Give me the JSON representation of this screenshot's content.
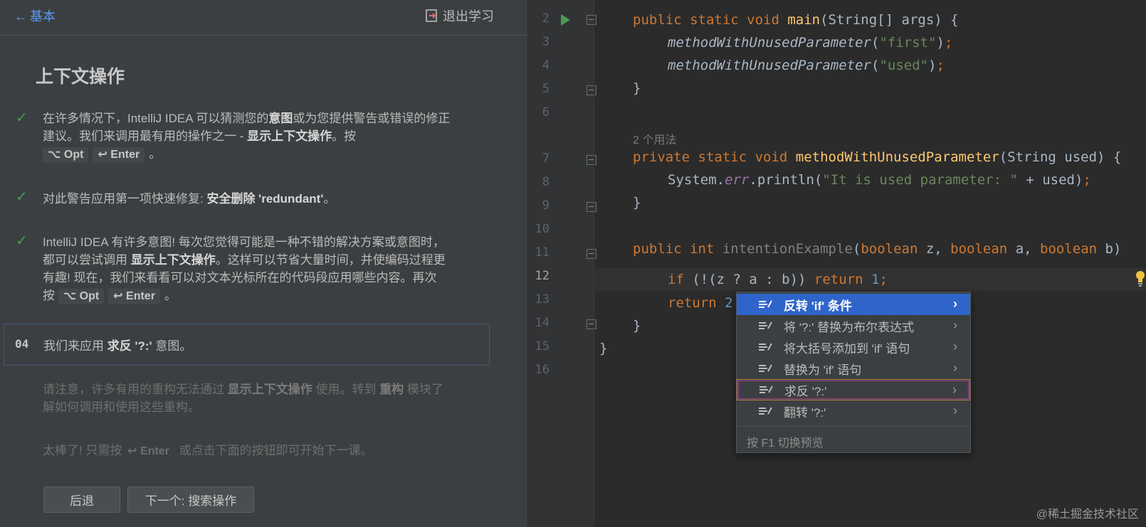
{
  "learn": {
    "back_label": "基本",
    "exit_label": "退出学习",
    "title": "上下文操作",
    "step1": {
      "t1": "在许多情况下，IntelliJ IDEA 可以猜测您的",
      "t1b": "意图",
      "t2": "或为您提供警告或错误的修正",
      "t3": "建议。我们来调用最有用的操作之一 - ",
      "t3b": "显示上下文操作",
      "t4": "。按",
      "k1": "⌥ Opt",
      "k2": "↩ Enter",
      "t5": "。"
    },
    "step2": {
      "t1": "对此警告应用第一项快速修复: ",
      "t1b": "安全删除 'redundant'",
      "t2": "。"
    },
    "step3": {
      "t1": "IntelliJ IDEA 有许多意图! 每次您觉得可能是一种不错的解决方案或意图时，",
      "t2": "都可以尝试调用 ",
      "t2b": "显示上下文操作",
      "t3": "。这样可以节省大量时间，并使编码过程更",
      "t4": "有趣! 现在，我们来看看可以对文本光标所在的代码段应用哪些内容。再次",
      "t5": "按",
      "k1": "⌥ Opt",
      "k2": "↩ Enter",
      "t6": "。"
    },
    "current": {
      "num": "04",
      "t1": "我们来应用 ",
      "t1b": "求反 '?:'",
      "t2": " 意图。"
    },
    "note1": {
      "t1": "请注意，许多有用的重构无法通过 ",
      "t1b": "显示上下文操作",
      "t2": " 使用。转到 ",
      "t2b": "重构",
      "t3": " 模块了",
      "t4": "解如何调用和使用这些重构。"
    },
    "note2": {
      "t1": "太棒了! 只需按 ",
      "k1": "↩ Enter",
      "t2": " 或点击下面的按钮即可开始下一课。"
    },
    "btn_back": "后退",
    "btn_next": "下一个: 搜索操作"
  },
  "editor": {
    "line_numbers": [
      "2",
      "3",
      "4",
      "5",
      "6",
      "7",
      "8",
      "9",
      "10",
      "11",
      "12",
      "13",
      "14",
      "15",
      "16"
    ],
    "usages_hint": "2 个用法",
    "code": {
      "l2_kw": "public static void ",
      "l2_fn": "main",
      "l2_rest": "(String[] args) {",
      "l3_call": "methodWithUnusedParameter",
      "l3_str": "\"first\"",
      "l4_call": "methodWithUnusedParameter",
      "l4_str": "\"used\"",
      "brace_close": "}",
      "l7_kw": "private static void ",
      "l7_fn": "methodWithUnusedParameter",
      "l7_rest": "(String used) {",
      "l8_a": "System.",
      "l8_field": "err",
      "l8_b": ".println(",
      "l8_str": "\"It is used parameter: \"",
      "l8_c": " + used)",
      "semi": ";",
      "l11_kw1": "public int ",
      "l11_fn": "intentionExample",
      "l11_p1": "(",
      "l11_kw2": "boolean",
      "l11_z": " z, ",
      "l11_kw3": "boolean",
      "l11_a": " a, ",
      "l11_kw4": "boolean",
      "l11_b": " b)",
      "l12_kw": "if",
      "l12_mid": " (!(z ? a : b)) ",
      "l12_ret": "return",
      "l12_num": "1",
      "l13_ret": "return",
      "l13_num": "2"
    }
  },
  "popup": {
    "items": [
      {
        "label": "反转 'if' 条件"
      },
      {
        "label": "将 '?:' 替换为布尔表达式"
      },
      {
        "label": "将大括号添加到 'if' 语句"
      },
      {
        "label": "替换为 'if' 语句"
      },
      {
        "label": "求反 '?:'"
      },
      {
        "label": "翻转 '?:'"
      }
    ],
    "footer": "按 F1 切换预览"
  },
  "watermark": "@稀土掘金技术社区",
  "colors": {
    "accent": "#589df6",
    "selection": "#2f65ca",
    "check": "#499c54"
  }
}
